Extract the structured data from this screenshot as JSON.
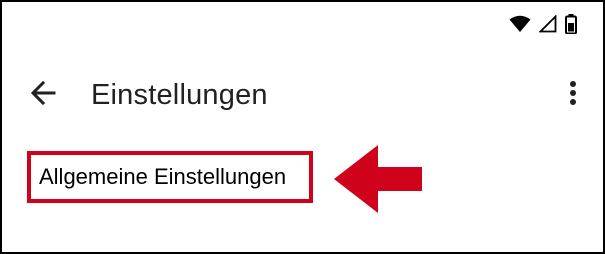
{
  "status_bar": {
    "icons": [
      "wifi-icon",
      "cell-signal-icon",
      "battery-icon"
    ]
  },
  "app_bar": {
    "back_icon": "arrow-left-icon",
    "title": "Einstellungen",
    "menu_icon": "more-vert-icon"
  },
  "settings": {
    "items": [
      {
        "label": "Allgemeine Einstellungen",
        "highlighted": true
      }
    ]
  },
  "annotation": {
    "arrow_icon": "arrow-left-icon",
    "color": "#d0021b"
  },
  "colors": {
    "highlight": "#d0021b",
    "text": "#202124",
    "frame": "#000000"
  }
}
